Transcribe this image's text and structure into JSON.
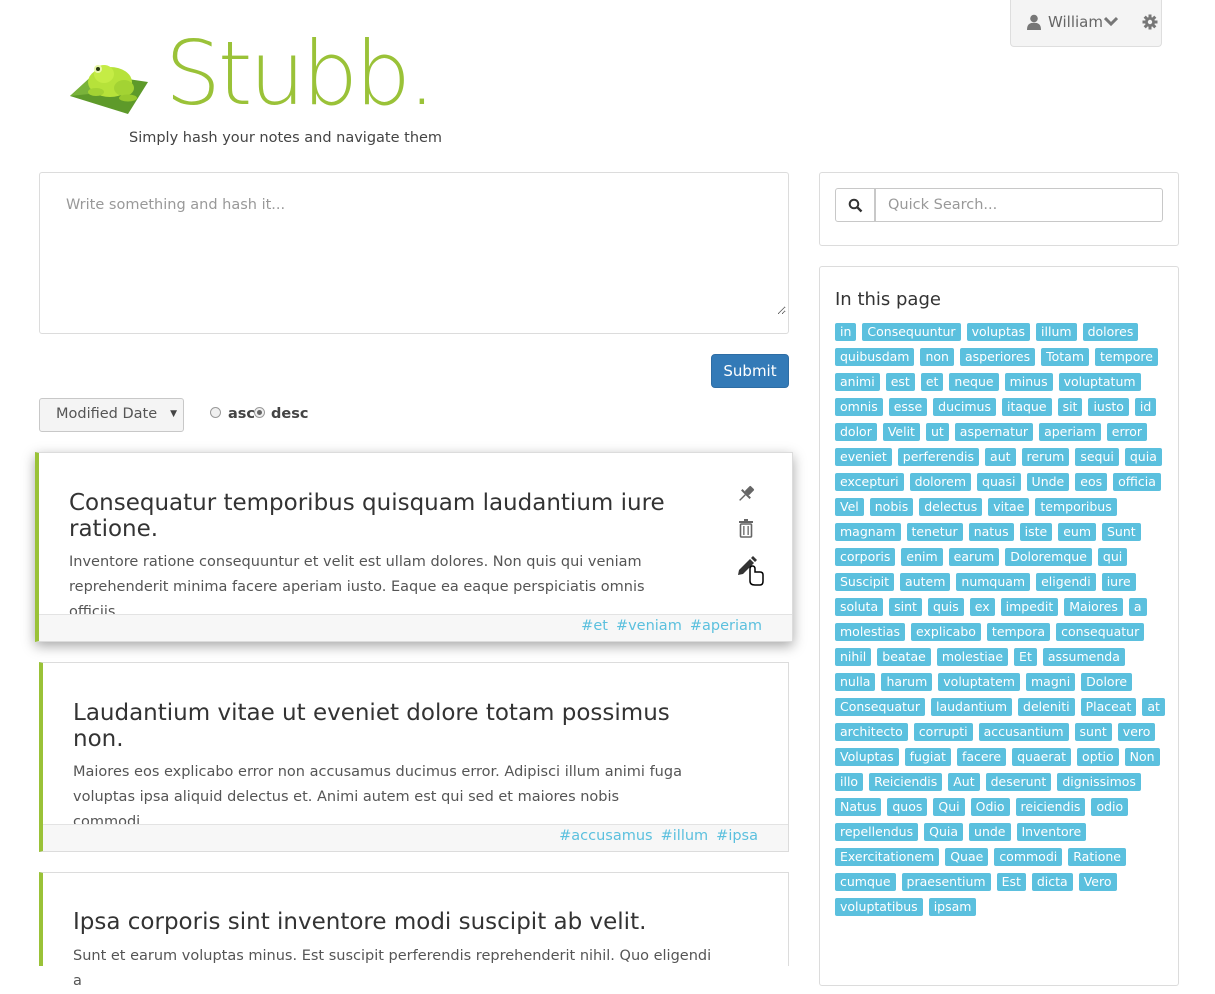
{
  "user": {
    "name": "William"
  },
  "brand": {
    "name": "Stubb.",
    "tagline": "Simply hash your notes and navigate them",
    "accent": "#9ac238"
  },
  "composer": {
    "placeholder": "Write something and hash it...",
    "submit_label": "Submit"
  },
  "sort": {
    "selected": "Modified Date",
    "asc_label": "asc",
    "desc_label": "desc",
    "order": "desc"
  },
  "notes": [
    {
      "title": "Consequatur temporibus quisquam laudantium iure ratione.",
      "body": "Inventore ratione consequuntur et velit est ullam dolores. Non quis qui veniam reprehenderit minima facere aperiam iusto. Eaque ea eaque perspiciatis omnis officiis.",
      "tags": [
        "#et",
        "#veniam",
        "#aperiam"
      ]
    },
    {
      "title": "Laudantium vitae ut eveniet dolore totam possimus non.",
      "body": "Maiores eos explicabo error non accusamus ducimus error. Adipisci illum animi fuga voluptas ipsa aliquid delectus et. Animi autem est qui sed et maiores nobis commodi.",
      "tags": [
        "#accusamus",
        "#illum",
        "#ipsa"
      ]
    },
    {
      "title": "Ipsa corporis sint inventore modi suscipit ab velit.",
      "body": "Sunt et earum voluptas minus. Est suscipit perferendis reprehenderit nihil. Quo eligendi a",
      "tags": []
    }
  ],
  "search": {
    "placeholder": "Quick Search..."
  },
  "in_page": {
    "title": "In this page",
    "tags": [
      "in",
      "Consequuntur",
      "voluptas",
      "illum",
      "dolores",
      "quibusdam",
      "non",
      "asperiores",
      "Totam",
      "tempore",
      "animi",
      "est",
      "et",
      "neque",
      "minus",
      "voluptatum",
      "omnis",
      "esse",
      "ducimus",
      "itaque",
      "sit",
      "iusto",
      "id",
      "dolor",
      "Velit",
      "ut",
      "aspernatur",
      "aperiam",
      "error",
      "eveniet",
      "perferendis",
      "aut",
      "rerum",
      "sequi",
      "quia",
      "excepturi",
      "dolorem",
      "quasi",
      "Unde",
      "eos",
      "officia",
      "Vel",
      "nobis",
      "delectus",
      "vitae",
      "temporibus",
      "magnam",
      "tenetur",
      "natus",
      "iste",
      "eum",
      "Sunt",
      "corporis",
      "enim",
      "earum",
      "Doloremque",
      "qui",
      "Suscipit",
      "autem",
      "numquam",
      "eligendi",
      "iure",
      "soluta",
      "sint",
      "quis",
      "ex",
      "impedit",
      "Maiores",
      "a",
      "molestias",
      "explicabo",
      "tempora",
      "consequatur",
      "nihil",
      "beatae",
      "molestiae",
      "Et",
      "assumenda",
      "nulla",
      "harum",
      "voluptatem",
      "magni",
      "Dolore",
      "Consequatur",
      "laudantium",
      "deleniti",
      "Placeat",
      "at",
      "architecto",
      "corrupti",
      "accusantium",
      "sunt",
      "vero",
      "Voluptas",
      "fugiat",
      "facere",
      "quaerat",
      "optio",
      "Non",
      "illo",
      "Reiciendis",
      "Aut",
      "deserunt",
      "dignissimos",
      "Natus",
      "quos",
      "Qui",
      "Odio",
      "reiciendis",
      "odio",
      "repellendus",
      "Quia",
      "unde",
      "Inventore",
      "Exercitationem",
      "Quae",
      "commodi",
      "Ratione",
      "cumque",
      "praesentium",
      "Est",
      "dicta",
      "Vero",
      "voluptatibus",
      "ipsam"
    ]
  }
}
